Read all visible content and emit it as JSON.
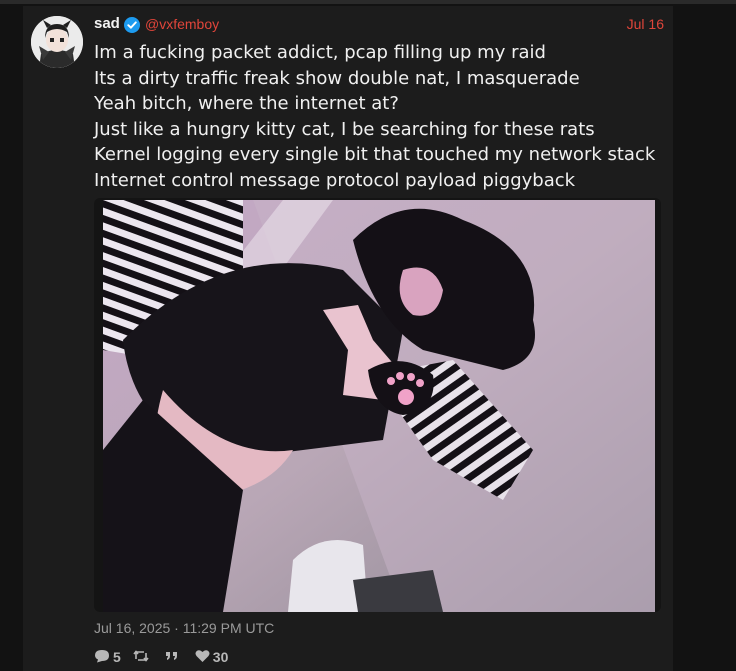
{
  "post": {
    "author_name": "sad",
    "author_handle": "@vxfemboy",
    "date_short": "Jul 16",
    "lines": [
      "Im a fucking packet addict, pcap filling up my raid",
      "Its a dirty traffic freak show double nat, I masquerade",
      "Yeah bitch, where the internet at?",
      "Just like a hungry kitty cat, I be searching for these rats",
      "Kernel logging every single bit that touched my network stack",
      "Internet control message protocol payload piggyback"
    ],
    "timestamp": "Jul 16, 2025 · 11:29 PM UTC",
    "stats": {
      "replies": "5",
      "reposts": "",
      "quotes": "",
      "likes": "30"
    }
  },
  "colors": {
    "accent": "#e0453a",
    "verified": "#1d9bf0",
    "background": "#1c1c1c"
  },
  "icons": {
    "verified": "verified-badge-icon",
    "reply": "reply-bubble-icon",
    "repost": "repost-icon",
    "quote": "quote-icon",
    "like": "heart-icon"
  }
}
